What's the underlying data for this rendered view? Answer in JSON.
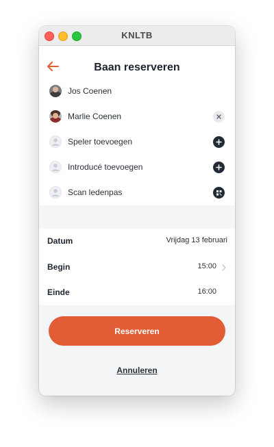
{
  "window": {
    "title": "KNLTB"
  },
  "header": {
    "title": "Baan reserveren",
    "back_icon": "arrow-left-icon",
    "accent": "#e25d35"
  },
  "players": [
    {
      "name": "Jos Coenen",
      "avatar": "photo",
      "action": null
    },
    {
      "name": "Marlie Coenen",
      "avatar": "photo",
      "action": "remove-icon"
    },
    {
      "name": "Speler toevoegen",
      "avatar": "user-placeholder-icon",
      "action": "plus-icon"
    },
    {
      "name": "Introducé toevoegen",
      "avatar": "user-placeholder-icon",
      "action": "plus-icon"
    },
    {
      "name": "Scan ledenpas",
      "avatar": "user-placeholder-icon",
      "action": "qr-code-icon"
    }
  ],
  "details": {
    "date": {
      "label": "Datum",
      "value": "Vrijdag 13 februari"
    },
    "start": {
      "label": "Begin",
      "value": "15:00"
    },
    "end": {
      "label": "Einde",
      "value": "16:00"
    }
  },
  "actions": {
    "primary": "Reserveren",
    "cancel": "Annuleren",
    "primary_color": "#e25d35"
  }
}
